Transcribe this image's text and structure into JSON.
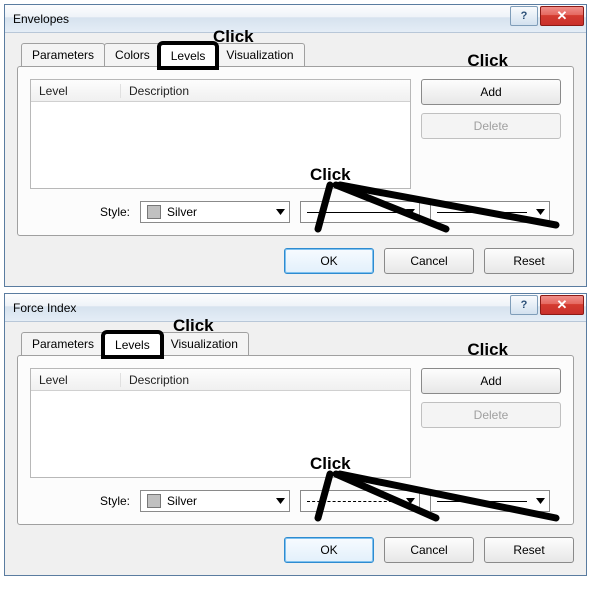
{
  "dialog1": {
    "title": "Envelopes",
    "tabs": [
      "Parameters",
      "Colors",
      "Levels",
      "Visualization"
    ],
    "active_tab": "Levels",
    "boxed_tab": "Levels",
    "grid_headers": {
      "level": "Level",
      "description": "Description"
    },
    "buttons": {
      "add": "Add",
      "delete": "Delete"
    },
    "style": {
      "label": "Style:",
      "color_name": "Silver",
      "line_variant": "solid",
      "thickness_variant": "solid"
    },
    "dlg_buttons": {
      "ok": "OK",
      "cancel": "Cancel",
      "reset": "Reset"
    },
    "annot_click_tab": "Click",
    "annot_click_add": "Click",
    "annot_click_style": "Click"
  },
  "dialog2": {
    "title": "Force Index",
    "tabs": [
      "Parameters",
      "Levels",
      "Visualization"
    ],
    "active_tab": "Levels",
    "boxed_tab": "Levels",
    "grid_headers": {
      "level": "Level",
      "description": "Description"
    },
    "buttons": {
      "add": "Add",
      "delete": "Delete"
    },
    "style": {
      "label": "Style:",
      "color_name": "Silver",
      "line_variant": "dashed",
      "thickness_variant": "solid"
    },
    "dlg_buttons": {
      "ok": "OK",
      "cancel": "Cancel",
      "reset": "Reset"
    },
    "annot_click_tab": "Click",
    "annot_click_add": "Click",
    "annot_click_style": "Click"
  },
  "help_glyph": "?",
  "close_glyph": "✕"
}
